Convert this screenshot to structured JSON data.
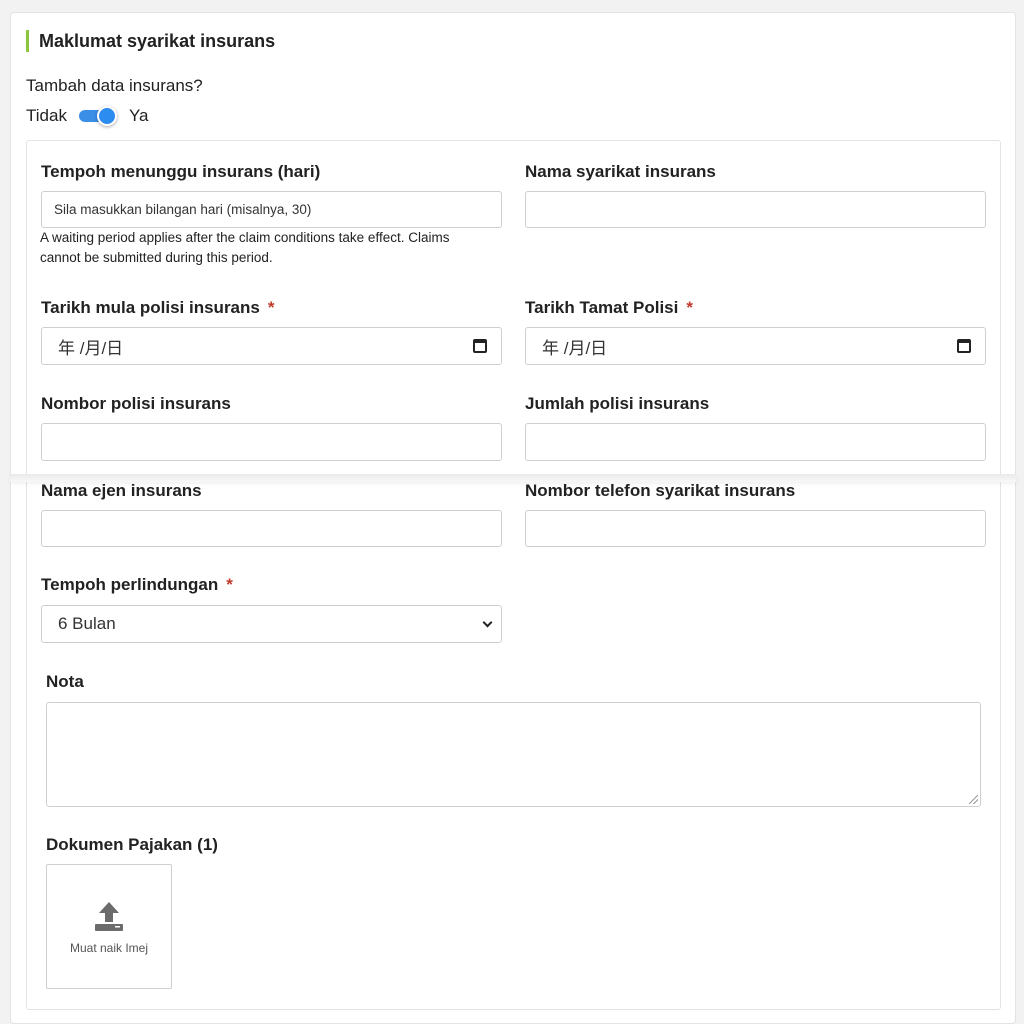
{
  "section": {
    "title": "Maklumat syarikat insurans",
    "question": "Tambah data insurans?",
    "toggle": {
      "off_label": "Tidak",
      "on_label": "Ya",
      "state": "on",
      "color": "#2d8cf0"
    }
  },
  "form": {
    "waiting_period": {
      "label": "Tempoh menunggu insurans (hari)",
      "placeholder": "Sila masukkan bilangan hari (misalnya, 30)",
      "help": "A waiting period applies after the claim conditions take effect. Claims cannot be submitted during this period."
    },
    "company_name": {
      "label": "Nama syarikat insurans",
      "value": ""
    },
    "policy_start": {
      "label": "Tarikh mula polisi insurans",
      "required": "*",
      "value": "年 /月/日"
    },
    "policy_end": {
      "label": "Tarikh Tamat Polisi",
      "required": "*",
      "value": "年 /月/日"
    },
    "policy_number": {
      "label": "Nombor polisi insurans",
      "value": ""
    },
    "policy_amount": {
      "label": "Jumlah polisi insurans",
      "value": ""
    },
    "agent_name": {
      "label": "Nama ejen insurans",
      "value": ""
    },
    "company_phone": {
      "label": "Nombor telefon syarikat insurans",
      "value": ""
    },
    "coverage_period": {
      "label": "Tempoh perlindungan",
      "required": "*",
      "value": "6 Bulan"
    },
    "notes": {
      "label": "Nota",
      "value": ""
    },
    "tax_docs": {
      "label": "Dokumen Pajakan (1)",
      "upload_label": "Muat naik Imej",
      "icon": "upload-icon"
    }
  },
  "colors": {
    "accent": "#8cc63f",
    "required": "#c0392b",
    "toggle": "#2d8cf0"
  }
}
